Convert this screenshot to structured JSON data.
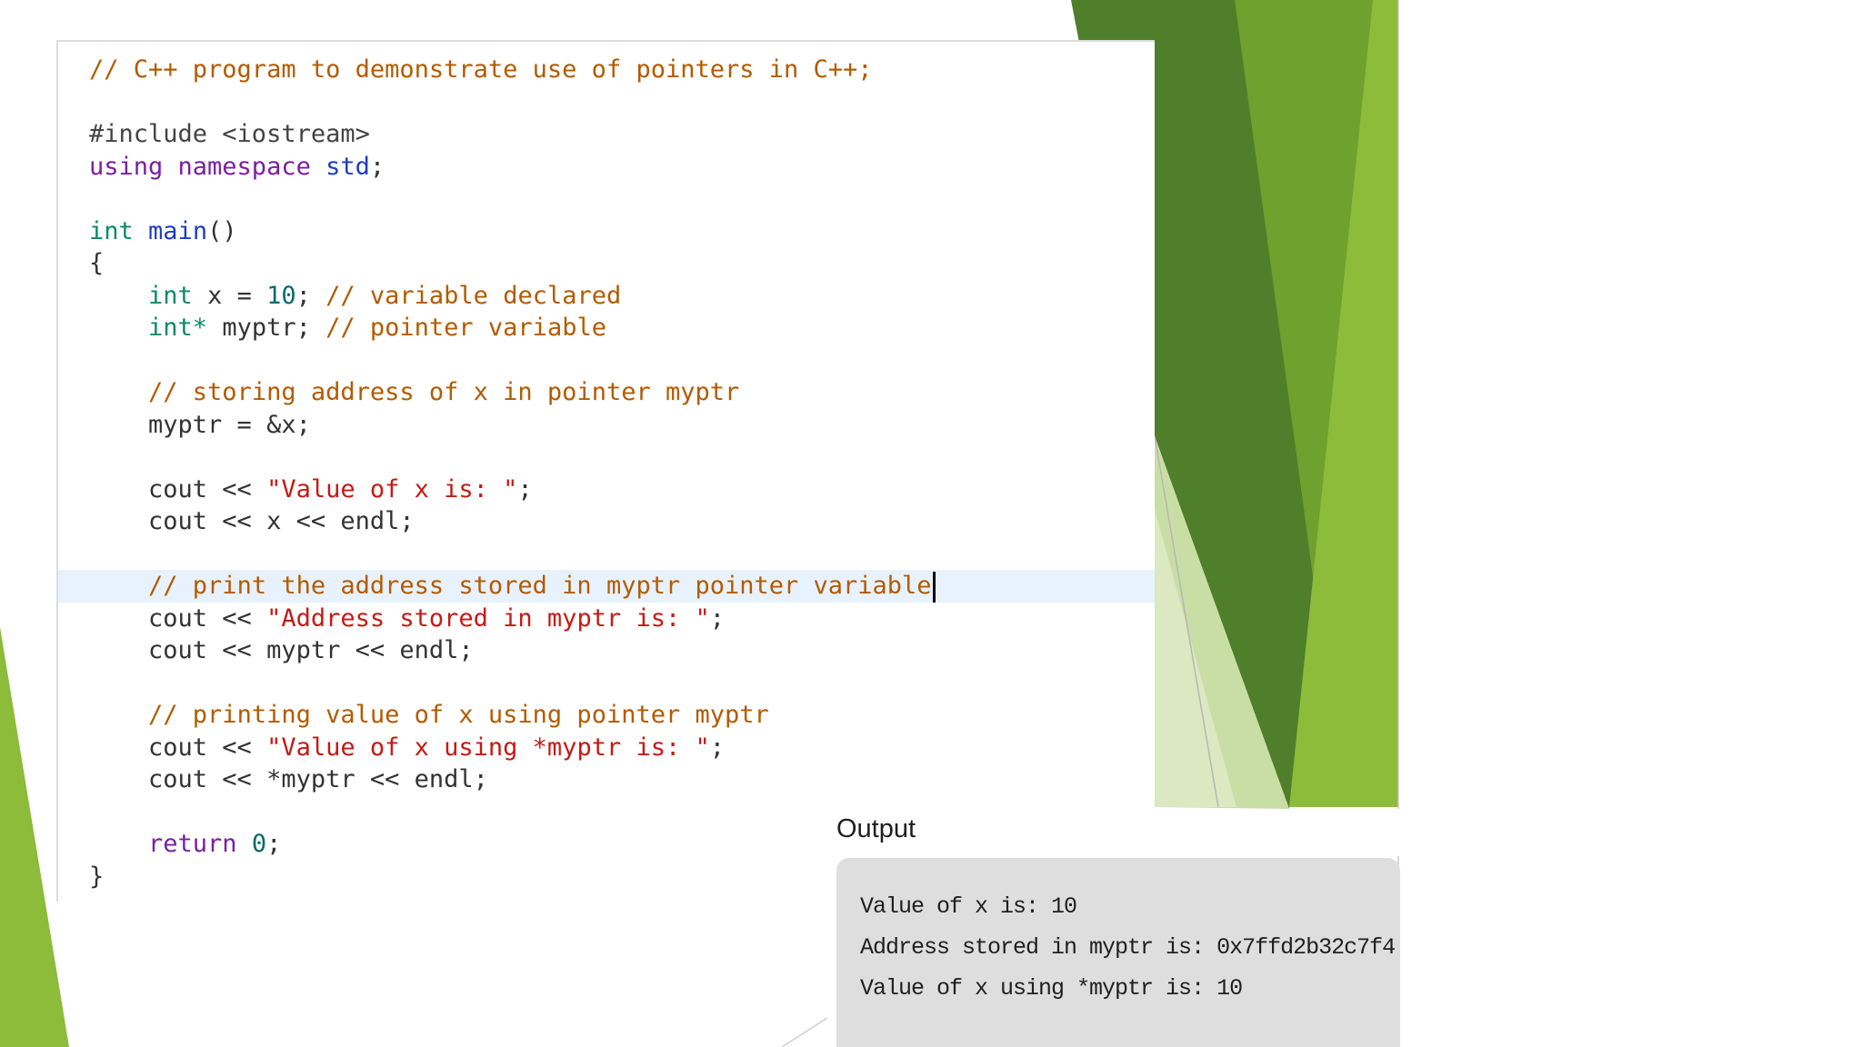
{
  "colors": {
    "accent_dark_green": "#4f7f2a",
    "accent_green": "#6ea12d",
    "accent_light_green": "#8dbb3a",
    "comment": "#b35b00",
    "keyword": "#7a1fa2",
    "type": "#0a8a6a",
    "string": "#c41a16",
    "active_line": "#e8f2fe",
    "output_background": "#dedede"
  },
  "editor": {
    "lines": [
      [
        {
          "t": "// C++ program to demonstrate use of pointers in C++;",
          "c": "comment"
        }
      ],
      [],
      [
        {
          "t": "#include <iostream>",
          "c": "pre"
        }
      ],
      [
        {
          "t": "using namespace ",
          "c": "kw"
        },
        {
          "t": "std",
          "c": "fn"
        },
        {
          "t": ";",
          "c": ""
        }
      ],
      [],
      [
        {
          "t": "int",
          "c": "type"
        },
        {
          "t": " ",
          "c": ""
        },
        {
          "t": "main",
          "c": "fn"
        },
        {
          "t": "()",
          "c": ""
        }
      ],
      [
        {
          "t": "{",
          "c": ""
        }
      ],
      [
        {
          "t": "    ",
          "c": ""
        },
        {
          "t": "int",
          "c": "type"
        },
        {
          "t": " x = ",
          "c": ""
        },
        {
          "t": "10",
          "c": "num"
        },
        {
          "t": "; ",
          "c": ""
        },
        {
          "t": "// variable declared",
          "c": "comment"
        }
      ],
      [
        {
          "t": "    ",
          "c": ""
        },
        {
          "t": "int*",
          "c": "type"
        },
        {
          "t": " myptr; ",
          "c": ""
        },
        {
          "t": "// pointer variable",
          "c": "comment"
        }
      ],
      [],
      [
        {
          "t": "    ",
          "c": ""
        },
        {
          "t": "// storing address of x in pointer myptr",
          "c": "comment"
        }
      ],
      [
        {
          "t": "    myptr = &x;",
          "c": ""
        }
      ],
      [],
      [
        {
          "t": "    cout << ",
          "c": ""
        },
        {
          "t": "\"Value of x is: \"",
          "c": "str"
        },
        {
          "t": ";",
          "c": ""
        }
      ],
      [
        {
          "t": "    cout << x << endl;",
          "c": ""
        }
      ],
      [],
      [
        {
          "t": "    ",
          "c": ""
        },
        {
          "t": "// print the address stored in myptr pointer variable",
          "c": "comment"
        }
      ],
      [
        {
          "t": "    cout << ",
          "c": ""
        },
        {
          "t": "\"Address stored in myptr is: \"",
          "c": "str"
        },
        {
          "t": ";",
          "c": ""
        }
      ],
      [
        {
          "t": "    cout << myptr << endl;",
          "c": ""
        }
      ],
      [],
      [
        {
          "t": "    ",
          "c": ""
        },
        {
          "t": "// printing value of x using pointer myptr",
          "c": "comment"
        }
      ],
      [
        {
          "t": "    cout << ",
          "c": ""
        },
        {
          "t": "\"Value of x using *myptr is: \"",
          "c": "str"
        },
        {
          "t": ";",
          "c": ""
        }
      ],
      [
        {
          "t": "    cout << *myptr << endl;",
          "c": ""
        }
      ],
      [],
      [
        {
          "t": "    ",
          "c": ""
        },
        {
          "t": "return",
          "c": "kw"
        },
        {
          "t": " ",
          "c": ""
        },
        {
          "t": "0",
          "c": "num"
        },
        {
          "t": ";",
          "c": ""
        }
      ],
      [
        {
          "t": "}",
          "c": ""
        }
      ]
    ],
    "active_line_index": 16
  },
  "output": {
    "title": "Output",
    "lines": [
      "Value of x is: 10",
      "Address stored in myptr is: 0x7ffd2b32c7f4",
      "Value of x using *myptr is: 10"
    ]
  }
}
